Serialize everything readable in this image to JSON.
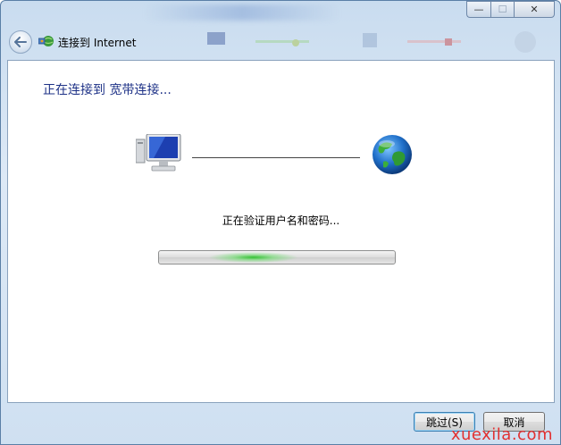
{
  "window": {
    "title": "连接到 Internet",
    "caption_buttons": {
      "minimize_glyph": "—",
      "maximize_glyph": "☐",
      "close_glyph": "✕"
    },
    "back_glyph": "⮜"
  },
  "main": {
    "heading": "正在连接到 宽带连接...",
    "status_text": "正在验证用户名和密码...",
    "progress": {
      "style": "indeterminate marquee",
      "accent": "#34c234"
    }
  },
  "buttons": {
    "skip_label": "跳过(S)",
    "cancel_label": "取消"
  },
  "watermark": "xuexila.com",
  "colors": {
    "heading_color": "#1e3287",
    "watermark_color": "#e23030",
    "frame_color": "#c9dcef"
  },
  "icons": [
    "back-arrow-icon",
    "network-icon",
    "computer-icon",
    "globe-icon"
  ]
}
